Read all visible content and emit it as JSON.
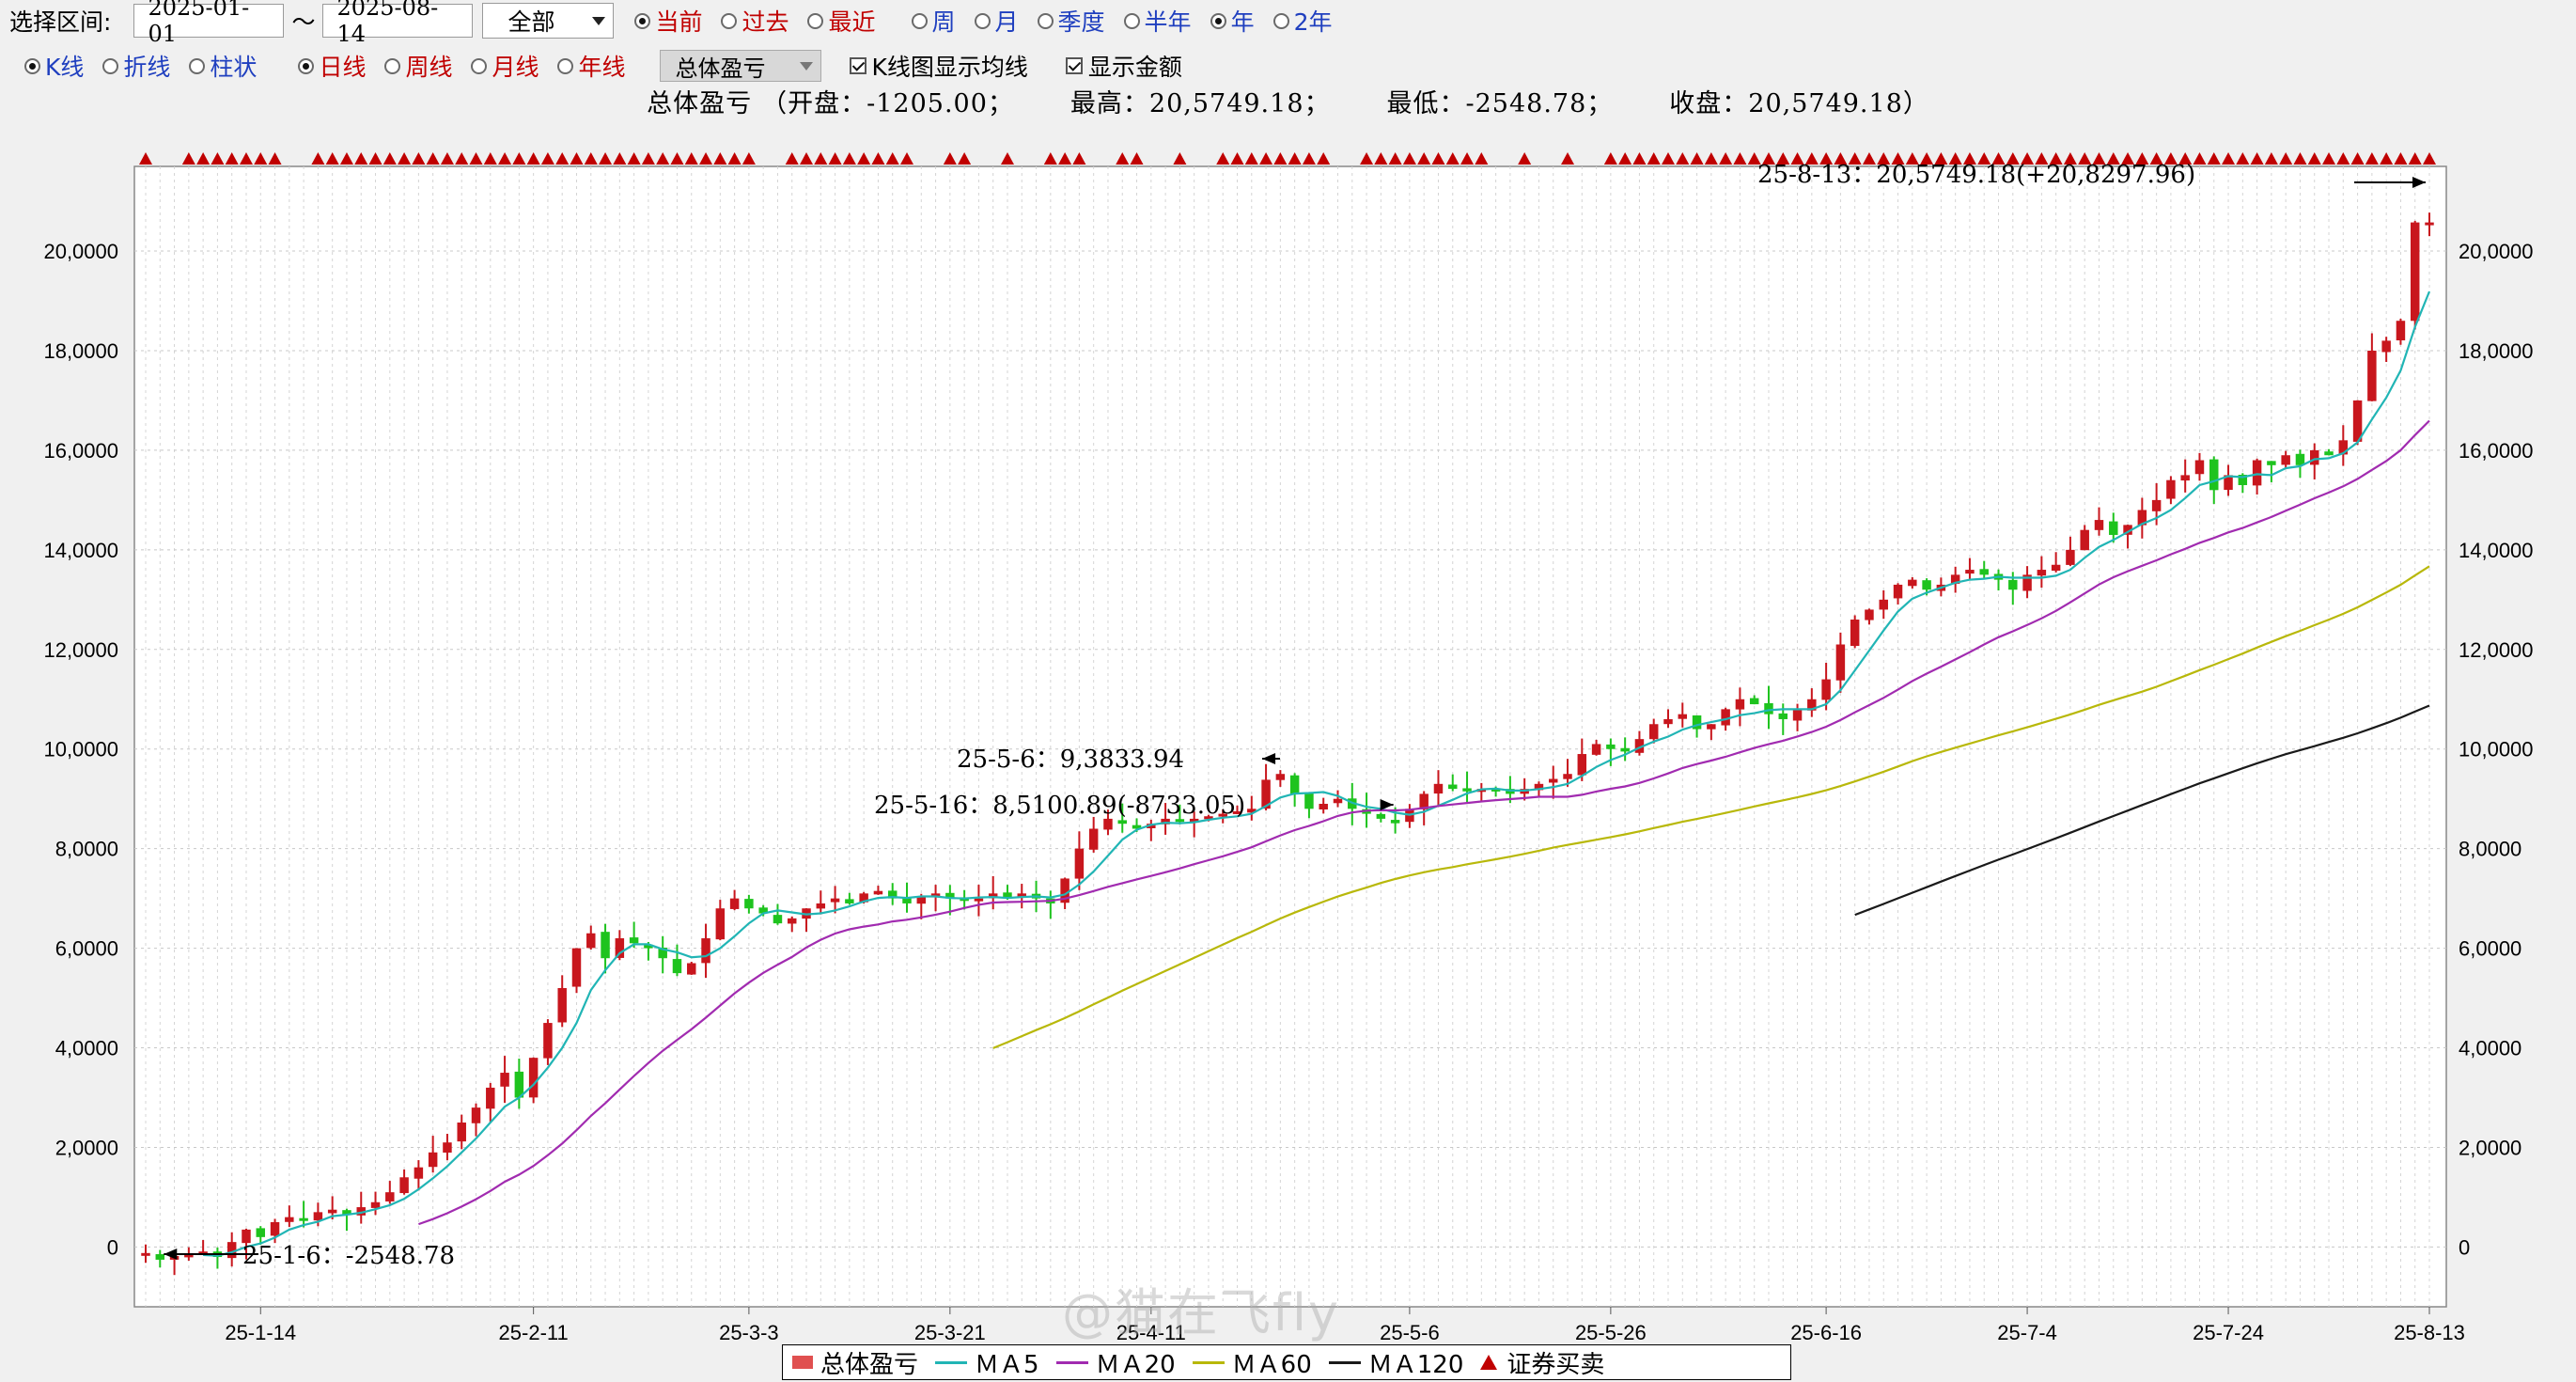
{
  "toolbar": {
    "range_label": "选择区间:",
    "start_date": "2025-01-01",
    "tilde": "～",
    "end_date": "2025-08-14",
    "scope_value": "全部",
    "period_radios": [
      {
        "label": "当前",
        "checked": true
      },
      {
        "label": "过去",
        "checked": false
      },
      {
        "label": "最近",
        "checked": false
      }
    ],
    "span_radios": [
      {
        "label": "周",
        "checked": false
      },
      {
        "label": "月",
        "checked": false
      },
      {
        "label": "季度",
        "checked": false
      },
      {
        "label": "半年",
        "checked": false
      },
      {
        "label": "年",
        "checked": true
      },
      {
        "label": "2年",
        "checked": false
      }
    ]
  },
  "toolbar2": {
    "chart_type_radios": [
      {
        "label": "K线",
        "checked": true
      },
      {
        "label": "折线",
        "checked": false
      },
      {
        "label": "柱状",
        "checked": false
      }
    ],
    "interval_radios": [
      {
        "label": "日线",
        "checked": true
      },
      {
        "label": "周线",
        "checked": false
      },
      {
        "label": "月线",
        "checked": false
      },
      {
        "label": "年线",
        "checked": false
      }
    ],
    "metric_value": "总体盈亏",
    "checkboxes": [
      {
        "label": "K线图显示均线",
        "checked": true
      },
      {
        "label": "显示金额",
        "checked": true
      }
    ]
  },
  "summary": {
    "name": "总体盈亏",
    "open": "（开盘：-1205.00；",
    "high": "最高：20,5749.18；",
    "low": "最低：-2548.78；",
    "close": "收盘：20,5749.18）"
  },
  "annotations": {
    "max_label": "25-8-13：20,5749.18(+20,8297.96)",
    "peak1_label": "25-5-6：9,3833.94",
    "peak2_label": "25-5-16：8,5100.89(-8733.05)",
    "min_label": "25-1-6：-2548.78"
  },
  "legend": {
    "items": [
      "总体盈亏",
      "ＭＡ5",
      "ＭＡ20",
      "ＭＡ60",
      "ＭＡ120",
      "证券买卖"
    ]
  },
  "watermark": "@猫在飞fly",
  "colors": {
    "up": "#c8161d",
    "down": "#1ec31e",
    "ma5": "#21b5b5",
    "ma20": "#a12bb0",
    "ma60": "#b8b80a",
    "ma120": "#1a1a1a",
    "trade_marker": "#c00000"
  },
  "chart_data": {
    "type": "candlestick",
    "y_ticks": [
      "0",
      "2,0000",
      "4,0000",
      "6,0000",
      "8,0000",
      "10,0000",
      "12,0000",
      "14,0000",
      "16,0000",
      "18,0000",
      "20,0000"
    ],
    "ylim": [
      -12000,
      217000
    ],
    "x_ticks": [
      {
        "label": "25-1-14",
        "index": 8
      },
      {
        "label": "25-2-11",
        "index": 27
      },
      {
        "label": "25-3-3",
        "index": 42
      },
      {
        "label": "25-3-21",
        "index": 56
      },
      {
        "label": "25-4-11",
        "index": 70
      },
      {
        "label": "25-5-6",
        "index": 88
      },
      {
        "label": "25-5-26",
        "index": 102
      },
      {
        "label": "25-6-16",
        "index": 117
      },
      {
        "label": "25-7-4",
        "index": 131
      },
      {
        "label": "25-7-24",
        "index": 145
      },
      {
        "label": "25-8-13",
        "index": 159
      }
    ],
    "n_days": 160,
    "closes": [
      -1205,
      -2548,
      -1800,
      -1500,
      -900,
      -2000,
      1000,
      3500,
      2000,
      5000,
      6000,
      5500,
      7000,
      7500,
      6500,
      8000,
      9000,
      11000,
      14000,
      16000,
      19000,
      21000,
      25000,
      28000,
      32000,
      35000,
      30000,
      38000,
      45000,
      52000,
      60000,
      63000,
      58000,
      62000,
      61000,
      60000,
      58000,
      55000,
      57000,
      62000,
      68000,
      70000,
      68000,
      67000,
      65000,
      66000,
      68000,
      69000,
      70000,
      69000,
      71000,
      71500,
      70000,
      69000,
      70500,
      71000,
      70000,
      69500,
      70000,
      71000,
      70000,
      71000,
      70000,
      69000,
      74000,
      80000,
      84000,
      86000,
      85000,
      84000,
      85000,
      86000,
      85500,
      86000,
      86500,
      87000,
      87500,
      88000,
      93834,
      95000,
      91000,
      88000,
      89000,
      90000,
      88000,
      87000,
      86000,
      85100,
      88000,
      91000,
      93000,
      92000,
      91500,
      92000,
      91800,
      91000,
      92000,
      93000,
      94000,
      95000,
      99000,
      101000,
      100000,
      99500,
      102000,
      105000,
      106000,
      107000,
      104000,
      105000,
      108000,
      110000,
      109000,
      107000,
      106000,
      108000,
      110000,
      114000,
      121000,
      126000,
      128000,
      130000,
      133000,
      134000,
      132000,
      133000,
      135000,
      136000,
      135000,
      134000,
      132000,
      135000,
      136000,
      137000,
      140000,
      144000,
      146000,
      143000,
      145000,
      148000,
      150000,
      154000,
      155000,
      158000,
      152000,
      155000,
      153000,
      158000,
      157000,
      159000,
      157000,
      160000,
      159000,
      162000,
      170000,
      180000,
      182000,
      186000,
      205749,
      205749
    ]
  }
}
